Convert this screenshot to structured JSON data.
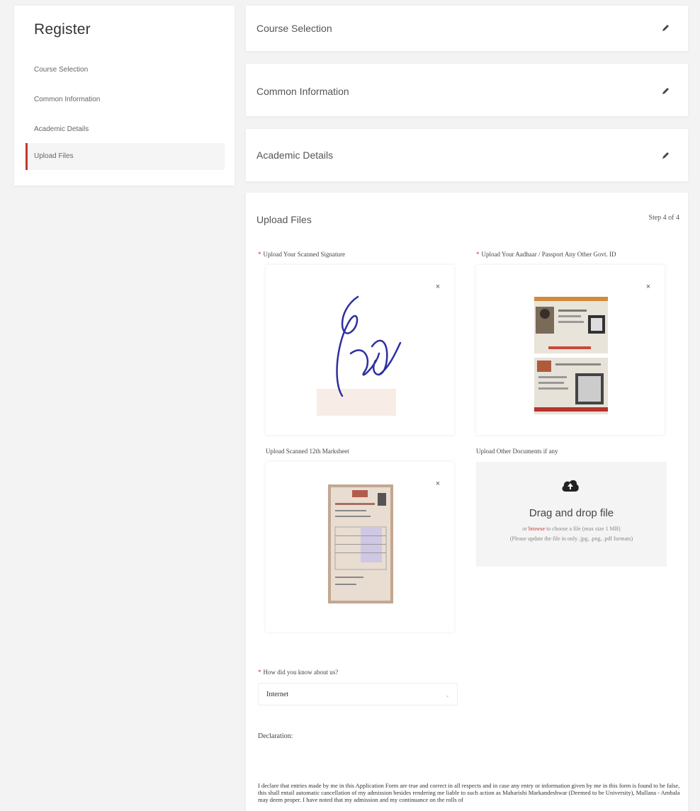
{
  "sidebar": {
    "title": "Register",
    "items": [
      {
        "label": "Course Selection"
      },
      {
        "label": "Common Information"
      },
      {
        "label": "Academic Details"
      },
      {
        "label": "Upload Files"
      }
    ]
  },
  "sections": {
    "course_selection": "Course Selection",
    "common_information": "Common Information",
    "academic_details": "Academic Details"
  },
  "upload": {
    "title": "Upload Files",
    "step": "Step 4 of 4",
    "signature_label": "Upload Your Scanned Signature",
    "id_label": "Upload Your Aadhaar / Passport Any Other Govt. ID",
    "marksheet_label": "Upload Scanned 12th Marksheet",
    "other_label": "Upload Other Documents if any",
    "remove": "×",
    "dropzone": {
      "title": "Drag and drop file",
      "or": "or",
      "browse": "browse",
      "choose": "to choose a file (max size 1 MB)",
      "note": "(Please update the file in only .jpg, .png, .pdf formats)"
    }
  },
  "question": {
    "label": "How did you know about us?",
    "value": "Internet"
  },
  "declaration": {
    "label": "Declaration:",
    "text": "I declare that entries made by me in this Application Form are true and correct in all respects and in case any entry or information given by me in this form is found to be false, this shall entail automatic cancellation of my admission besides rendering me liable to such action as Maharishi Markandeshwar (Deemed to be University), Mullana - Ambala may deem proper. I have noted that my admission and my continuance on the rolls of"
  },
  "colors": {
    "accent": "#c0392b",
    "background": "#f3f3f3"
  },
  "icons": [
    "edit-icon",
    "close-icon",
    "cloud-upload-icon",
    "chevron-down-icon"
  ]
}
